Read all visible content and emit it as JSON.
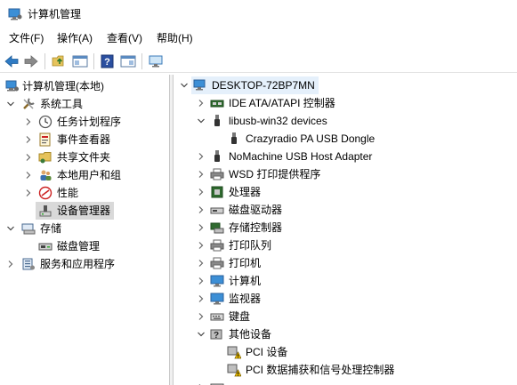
{
  "window": {
    "title": "计算机管理"
  },
  "menu": {
    "file": "文件(F)",
    "action": "操作(A)",
    "view": "查看(V)",
    "help": "帮助(H)"
  },
  "toolbar": {
    "icons": [
      "back-arrow-icon",
      "forward-arrow-icon",
      "up-folder-icon",
      "show-hide-tree-icon",
      "help-icon",
      "action-pane-icon",
      "monitor-icon"
    ]
  },
  "left_tree": {
    "root": "计算机管理(本地)",
    "system_tools": "系统工具",
    "task_scheduler": "任务计划程序",
    "event_viewer": "事件查看器",
    "shared_folders": "共享文件夹",
    "local_users": "本地用户和组",
    "performance": "性能",
    "device_manager": "设备管理器",
    "storage": "存储",
    "disk_management": "磁盘管理",
    "services_apps": "服务和应用程序"
  },
  "device_tree": {
    "computer": "DESKTOP-72BP7MN",
    "ide": "IDE ATA/ATAPI 控制器",
    "libusb": "libusb-win32 devices",
    "crazyradio": "Crazyradio PA USB Dongle",
    "nomachine": "NoMachine USB Host Adapter",
    "wsd": "WSD 打印提供程序",
    "processor": "处理器",
    "disk_drives": "磁盘驱动器",
    "storage_ctrl": "存储控制器",
    "print_queue": "打印队列",
    "printers": "打印机",
    "computer_node": "计算机",
    "monitors": "监视器",
    "keyboards": "键盘",
    "other_devices": "其他设备",
    "pci_device": "PCI 设备",
    "pci_data": "PCI 数据捕获和信号处理控制器"
  },
  "colors": {
    "selection": "#d9d9d9",
    "warning": "#f5c400",
    "accent_blue": "#2b6cb0"
  }
}
